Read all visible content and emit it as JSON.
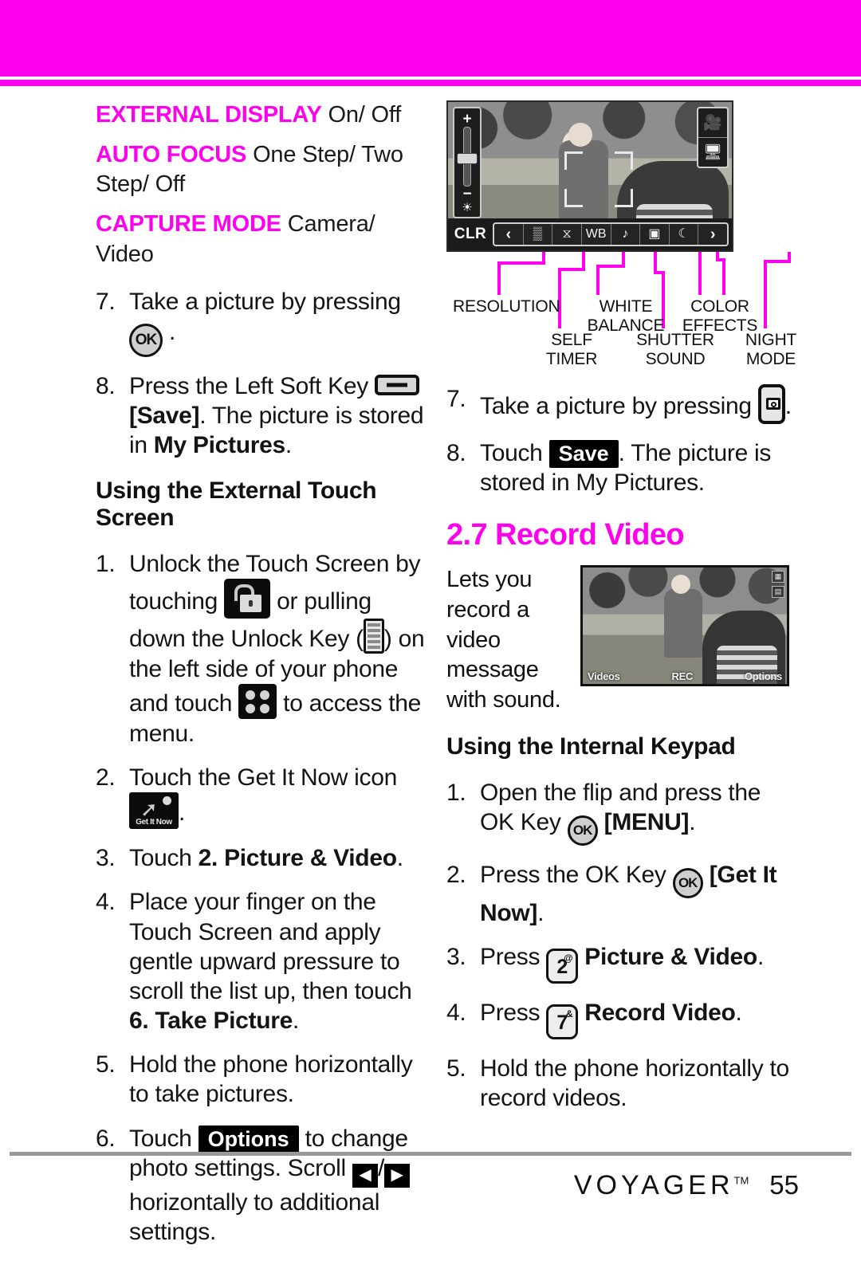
{
  "header": {
    "band_color": "#ff00ee"
  },
  "left_column": {
    "settings": [
      {
        "name": "EXTERNAL DISPLAY",
        "values": "On/ Off"
      },
      {
        "name": "AUTO FOCUS",
        "values": "One Step/ Two Step/ Off"
      },
      {
        "name": "CAPTURE MODE",
        "values": "Camera/ Video"
      }
    ],
    "steps_top": [
      {
        "num": "7.",
        "pre": "Take a picture by pressing",
        "icon": "ok-key",
        "post": "."
      },
      {
        "num": "8.",
        "pre": "Press the Left Soft Key",
        "icon": "left-soft-key",
        "post_bold": "[Save]",
        "post": ". The picture is stored in",
        "post_bold2": "My Pictures",
        "post_end": "."
      }
    ],
    "subhead": "Using the External Touch Screen",
    "steps": [
      {
        "num": "1.",
        "text_a": "Unlock the Touch Screen by touching",
        "icon_a": "padlock-unlock-icon",
        "text_b": "or pulling down the Unlock Key (",
        "icon_b": "unlock-key-icon",
        "text_c": ") on the left side of your phone and touch",
        "icon_c": "menu-grid-icon",
        "text_d": "to access the menu."
      },
      {
        "num": "2.",
        "text_a": "Touch the Get It Now icon",
        "icon_a": "get-it-now-icon",
        "text_b": "."
      },
      {
        "num": "3.",
        "text_a": "Touch",
        "bold": "2. Picture & Video",
        "text_b": "."
      },
      {
        "num": "4.",
        "text_a": "Place your finger on the Touch Screen and apply gentle upward pressure to scroll the list up, then touch",
        "bold": "6. Take Picture",
        "text_b": "."
      },
      {
        "num": "5.",
        "text_a": "Hold the phone horizontally to take pictures."
      },
      {
        "num": "6.",
        "text_a": "Touch",
        "chip": "Options",
        "text_b": "to change photo settings. Scroll",
        "arrow_left": "◀",
        "slash": "/",
        "arrow_right": "▶",
        "text_c": "horizontally to additional settings."
      }
    ]
  },
  "camera_screenshot": {
    "clr_label": "CLR",
    "zoom_plus": "+",
    "zoom_minus": "−",
    "brightness_icon": "☀",
    "right_buttons": [
      "camcorder-icon",
      "display-icon"
    ],
    "toolbar_items": [
      "prev-arrow",
      "resolution-grid-icon",
      "self-timer-icon",
      "white-balance-icon",
      "shutter-sound-icon",
      "color-effects-icon",
      "night-mode-icon",
      "next-arrow"
    ],
    "toolbar_glyphs": [
      "‹",
      "▒",
      "⧖",
      "WB",
      "♪",
      "▣",
      "☾",
      "›"
    ]
  },
  "callouts": [
    {
      "label": "RESOLUTION",
      "lines": [
        "RESOLUTION"
      ]
    },
    {
      "label": "SELF TIMER",
      "lines": [
        "SELF",
        "TIMER"
      ]
    },
    {
      "label": "WHITE BALANCE",
      "lines": [
        "WHITE",
        "BALANCE"
      ]
    },
    {
      "label": "SHUTTER SOUND",
      "lines": [
        "SHUTTER",
        "SOUND"
      ]
    },
    {
      "label": "COLOR EFFECTS",
      "lines": [
        "COLOR",
        "EFFECTS"
      ]
    },
    {
      "label": "NIGHT MODE",
      "lines": [
        "NIGHT",
        "MODE"
      ]
    }
  ],
  "right_column": {
    "steps_top": [
      {
        "num": "7.",
        "text_a": "Take a picture by pressing",
        "icon": "camera-key-icon",
        "text_b": "."
      },
      {
        "num": "8.",
        "text_a": "Touch",
        "chip": "Save",
        "text_b": ". The picture is stored in My Pictures."
      }
    ],
    "section_heading": "2.7 Record Video",
    "intro_text": "Lets you record a video message with sound.",
    "video_screenshot": {
      "left_soft": "Videos",
      "center_soft": "REC",
      "right_soft": "Options",
      "badges": [
        "▦",
        "▤"
      ]
    },
    "subhead": "Using the Internal Keypad",
    "steps": [
      {
        "num": "1.",
        "text_a": "Open the flip and press the OK Key",
        "icon": "ok-key",
        "bold": "[MENU]",
        "text_b": "."
      },
      {
        "num": "2.",
        "text_a": "Press the OK Key",
        "icon": "ok-key",
        "bold": "[Get It Now]",
        "text_b": "."
      },
      {
        "num": "3.",
        "text_a": "Press",
        "key": "2",
        "key_sup": "@",
        "bold": "Picture & Video",
        "text_b": "."
      },
      {
        "num": "4.",
        "text_a": "Press",
        "key": "7",
        "key_sup": "&",
        "bold": "Record Video",
        "text_b": "."
      },
      {
        "num": "5.",
        "text_a": "Hold the phone horizontally to record videos."
      }
    ]
  },
  "footer": {
    "brand": "VOYAGER",
    "trademark": "TM",
    "page_number": "55"
  }
}
